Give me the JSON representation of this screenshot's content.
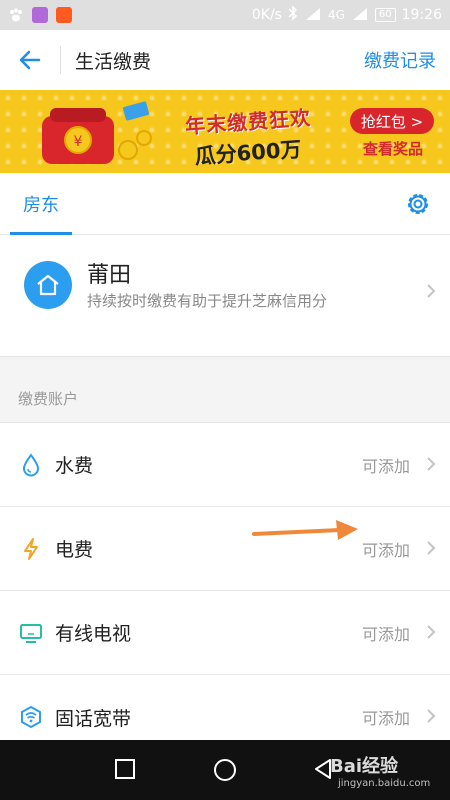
{
  "status_bar": {
    "speed": "0K/s",
    "network1": "4G",
    "battery": "60",
    "time": "19:26"
  },
  "nav": {
    "title": "生活缴费",
    "action": "缴费记录"
  },
  "banner": {
    "title": "年末缴费狂欢",
    "subtitle": "瓜分600万",
    "cta": "抢红包 >",
    "prize": "查看奖品"
  },
  "tabs": {
    "active": "房东"
  },
  "card": {
    "title": "莆田",
    "desc": "持续按时缴费有助于提升芝麻信用分"
  },
  "section": {
    "label": "缴费账户"
  },
  "items": [
    {
      "label": "水费",
      "status": "可添加",
      "icon": "water-drop-icon"
    },
    {
      "label": "电费",
      "status": "可添加",
      "icon": "lightning-icon"
    },
    {
      "label": "有线电视",
      "status": "可添加",
      "icon": "tv-icon"
    },
    {
      "label": "固话宽带",
      "status": "可添加",
      "icon": "broadband-icon"
    }
  ],
  "watermark": {
    "brand": "Bai经验",
    "url": "jingyan.baidu.com"
  },
  "colors": {
    "accent": "#1e8ee6",
    "banner": "#f6c71c",
    "annotation": "#f0883a"
  }
}
